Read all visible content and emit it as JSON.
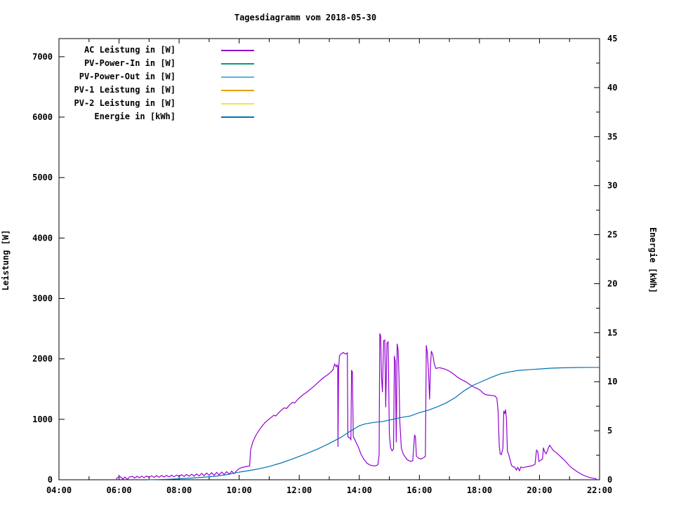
{
  "chart_data": {
    "type": "line",
    "title": "Tagesdiagramm vom 2018-05-30",
    "ylabel": "Leistung [W]",
    "y2label": "Energie [kWh]",
    "background": "#ffffff",
    "border_color": "#000000",
    "grid": false,
    "legend_position": "top-left-inside",
    "xlim": [
      4,
      22
    ],
    "ylim": [
      0,
      7300
    ],
    "y2lim": [
      0,
      45
    ],
    "x_ticks": [
      {
        "t": 4,
        "label": "04:00"
      },
      {
        "t": 6,
        "label": "06:00"
      },
      {
        "t": 8,
        "label": "08:00"
      },
      {
        "t": 10,
        "label": "10:00"
      },
      {
        "t": 12,
        "label": "12:00"
      },
      {
        "t": 14,
        "label": "14:00"
      },
      {
        "t": 16,
        "label": "16:00"
      },
      {
        "t": 18,
        "label": "18:00"
      },
      {
        "t": 20,
        "label": "20:00"
      },
      {
        "t": 22,
        "label": "22:00"
      }
    ],
    "x_minor_ticks": [
      5,
      7,
      9,
      11,
      13,
      15,
      17,
      19,
      21
    ],
    "y_ticks": [
      0,
      1000,
      2000,
      3000,
      4000,
      5000,
      6000,
      7000
    ],
    "y2_ticks": [
      0,
      5,
      10,
      15,
      20,
      25,
      30,
      35,
      40,
      45
    ],
    "y2_minor_ticks": [
      2.5,
      7.5,
      12.5,
      17.5,
      22.5,
      27.5,
      32.5,
      37.5,
      42.5
    ],
    "series": [
      {
        "name": "AC Leistung in [W]",
        "color": "#9400d3",
        "axis": "y1",
        "points": [
          [
            5.9,
            0
          ],
          [
            5.95,
            40
          ],
          [
            6.05,
            50
          ],
          [
            6.13,
            10
          ],
          [
            6.2,
            45
          ],
          [
            6.28,
            5
          ],
          [
            6.35,
            48
          ],
          [
            6.45,
            55
          ],
          [
            6.52,
            28
          ],
          [
            6.6,
            58
          ],
          [
            6.68,
            32
          ],
          [
            6.75,
            60
          ],
          [
            6.83,
            35
          ],
          [
            6.92,
            62
          ],
          [
            7.0,
            38
          ],
          [
            7.08,
            65
          ],
          [
            7.17,
            40
          ],
          [
            7.25,
            68
          ],
          [
            7.33,
            42
          ],
          [
            7.42,
            70
          ],
          [
            7.5,
            45
          ],
          [
            7.58,
            72
          ],
          [
            7.67,
            48
          ],
          [
            7.75,
            75
          ],
          [
            7.83,
            50
          ],
          [
            7.92,
            78
          ],
          [
            8.0,
            52
          ],
          [
            8.08,
            82
          ],
          [
            8.17,
            55
          ],
          [
            8.25,
            88
          ],
          [
            8.33,
            58
          ],
          [
            8.42,
            92
          ],
          [
            8.5,
            60
          ],
          [
            8.58,
            98
          ],
          [
            8.67,
            64
          ],
          [
            8.75,
            104
          ],
          [
            8.83,
            68
          ],
          [
            8.92,
            110
          ],
          [
            9.0,
            72
          ],
          [
            9.08,
            116
          ],
          [
            9.17,
            76
          ],
          [
            9.25,
            122
          ],
          [
            9.33,
            80
          ],
          [
            9.42,
            128
          ],
          [
            9.5,
            85
          ],
          [
            9.58,
            134
          ],
          [
            9.67,
            92
          ],
          [
            9.75,
            142
          ],
          [
            9.83,
            100
          ],
          [
            9.92,
            152
          ],
          [
            10.0,
            185
          ],
          [
            10.1,
            205
          ],
          [
            10.2,
            215
          ],
          [
            10.3,
            225
          ],
          [
            10.35,
            230
          ],
          [
            10.38,
            490
          ],
          [
            10.45,
            620
          ],
          [
            10.55,
            730
          ],
          [
            10.65,
            810
          ],
          [
            10.75,
            880
          ],
          [
            10.85,
            940
          ],
          [
            10.95,
            985
          ],
          [
            11.05,
            1025
          ],
          [
            11.15,
            1065
          ],
          [
            11.22,
            1055
          ],
          [
            11.3,
            1100
          ],
          [
            11.4,
            1150
          ],
          [
            11.5,
            1190
          ],
          [
            11.58,
            1180
          ],
          [
            11.68,
            1240
          ],
          [
            11.78,
            1280
          ],
          [
            11.85,
            1270
          ],
          [
            11.95,
            1330
          ],
          [
            12.05,
            1375
          ],
          [
            12.15,
            1415
          ],
          [
            12.25,
            1450
          ],
          [
            12.35,
            1490
          ],
          [
            12.45,
            1530
          ],
          [
            12.55,
            1575
          ],
          [
            12.65,
            1620
          ],
          [
            12.75,
            1665
          ],
          [
            12.85,
            1705
          ],
          [
            12.95,
            1740
          ],
          [
            13.05,
            1780
          ],
          [
            13.12,
            1815
          ],
          [
            13.18,
            1915
          ],
          [
            13.23,
            1870
          ],
          [
            13.26,
            1900
          ],
          [
            13.28,
            1890
          ],
          [
            13.29,
            545
          ],
          [
            13.31,
            1840
          ],
          [
            13.34,
            2050
          ],
          [
            13.4,
            2085
          ],
          [
            13.47,
            2105
          ],
          [
            13.54,
            2080
          ],
          [
            13.6,
            2100
          ],
          [
            13.62,
            710
          ],
          [
            13.68,
            690
          ],
          [
            13.72,
            665
          ],
          [
            13.74,
            1805
          ],
          [
            13.77,
            1790
          ],
          [
            13.8,
            710
          ],
          [
            13.85,
            665
          ],
          [
            13.9,
            610
          ],
          [
            13.97,
            540
          ],
          [
            14.05,
            430
          ],
          [
            14.15,
            340
          ],
          [
            14.25,
            275
          ],
          [
            14.35,
            245
          ],
          [
            14.45,
            232
          ],
          [
            14.55,
            230
          ],
          [
            14.62,
            250
          ],
          [
            14.66,
            420
          ],
          [
            14.68,
            2420
          ],
          [
            14.71,
            2380
          ],
          [
            14.74,
            1700
          ],
          [
            14.77,
            1450
          ],
          [
            14.81,
            2300
          ],
          [
            14.85,
            2310
          ],
          [
            14.88,
            1200
          ],
          [
            14.92,
            2260
          ],
          [
            14.96,
            2280
          ],
          [
            15.0,
            750
          ],
          [
            15.04,
            530
          ],
          [
            15.09,
            480
          ],
          [
            15.14,
            510
          ],
          [
            15.17,
            2050
          ],
          [
            15.2,
            1950
          ],
          [
            15.23,
            620
          ],
          [
            15.26,
            2250
          ],
          [
            15.29,
            2150
          ],
          [
            15.32,
            1750
          ],
          [
            15.35,
            950
          ],
          [
            15.4,
            520
          ],
          [
            15.46,
            430
          ],
          [
            15.52,
            380
          ],
          [
            15.6,
            330
          ],
          [
            15.7,
            305
          ],
          [
            15.78,
            315
          ],
          [
            15.84,
            745
          ],
          [
            15.87,
            700
          ],
          [
            15.9,
            390
          ],
          [
            15.98,
            355
          ],
          [
            16.06,
            345
          ],
          [
            16.14,
            365
          ],
          [
            16.2,
            385
          ],
          [
            16.23,
            2225
          ],
          [
            16.26,
            2120
          ],
          [
            16.3,
            1820
          ],
          [
            16.34,
            1330
          ],
          [
            16.37,
            1890
          ],
          [
            16.4,
            2130
          ],
          [
            16.45,
            2060
          ],
          [
            16.5,
            1910
          ],
          [
            16.55,
            1840
          ],
          [
            16.65,
            1855
          ],
          [
            16.75,
            1845
          ],
          [
            16.85,
            1830
          ],
          [
            16.95,
            1810
          ],
          [
            17.05,
            1780
          ],
          [
            17.15,
            1745
          ],
          [
            17.25,
            1705
          ],
          [
            17.35,
            1670
          ],
          [
            17.45,
            1645
          ],
          [
            17.55,
            1620
          ],
          [
            17.65,
            1585
          ],
          [
            17.75,
            1550
          ],
          [
            17.85,
            1525
          ],
          [
            17.95,
            1505
          ],
          [
            18.05,
            1470
          ],
          [
            18.12,
            1435
          ],
          [
            18.2,
            1410
          ],
          [
            18.3,
            1400
          ],
          [
            18.42,
            1395
          ],
          [
            18.52,
            1385
          ],
          [
            18.58,
            1350
          ],
          [
            18.62,
            1150
          ],
          [
            18.66,
            560
          ],
          [
            18.69,
            430
          ],
          [
            18.73,
            415
          ],
          [
            18.78,
            520
          ],
          [
            18.81,
            1140
          ],
          [
            18.84,
            1090
          ],
          [
            18.87,
            1160
          ],
          [
            18.9,
            1000
          ],
          [
            18.93,
            470
          ],
          [
            18.97,
            425
          ],
          [
            19.02,
            330
          ],
          [
            19.07,
            235
          ],
          [
            19.12,
            215
          ],
          [
            19.18,
            205
          ],
          [
            19.23,
            160
          ],
          [
            19.28,
            205
          ],
          [
            19.33,
            150
          ],
          [
            19.38,
            210
          ],
          [
            19.45,
            200
          ],
          [
            19.55,
            212
          ],
          [
            19.65,
            220
          ],
          [
            19.75,
            232
          ],
          [
            19.85,
            255
          ],
          [
            19.9,
            490
          ],
          [
            19.94,
            470
          ],
          [
            19.98,
            305
          ],
          [
            20.04,
            325
          ],
          [
            20.1,
            345
          ],
          [
            20.13,
            530
          ],
          [
            20.17,
            465
          ],
          [
            20.22,
            430
          ],
          [
            20.27,
            490
          ],
          [
            20.31,
            545
          ],
          [
            20.34,
            570
          ],
          [
            20.4,
            525
          ],
          [
            20.47,
            480
          ],
          [
            20.55,
            450
          ],
          [
            20.65,
            405
          ],
          [
            20.75,
            360
          ],
          [
            20.85,
            315
          ],
          [
            20.95,
            255
          ],
          [
            21.05,
            205
          ],
          [
            21.15,
            170
          ],
          [
            21.25,
            135
          ],
          [
            21.35,
            105
          ],
          [
            21.45,
            78
          ],
          [
            21.55,
            58
          ],
          [
            21.65,
            40
          ],
          [
            21.75,
            28
          ],
          [
            21.85,
            18
          ],
          [
            21.9,
            12
          ]
        ]
      },
      {
        "name": "PV-Power-In in [W]",
        "color": "#009e73",
        "axis": "y1",
        "points": []
      },
      {
        "name": "PV-Power-Out in [W]",
        "color": "#56b4e9",
        "axis": "y1",
        "points": []
      },
      {
        "name": "PV-1 Leistung in [W]",
        "color": "#e69f00",
        "axis": "y1",
        "points": []
      },
      {
        "name": "PV-2 Leistung in [W]",
        "color": "#f0e442",
        "axis": "y1",
        "points": []
      },
      {
        "name": "Energie in [kWh]",
        "color": "#0072b2",
        "axis": "y2",
        "points": [
          [
            6.95,
            0
          ],
          [
            7.3,
            0.02
          ],
          [
            7.7,
            0.06
          ],
          [
            8.0,
            0.1
          ],
          [
            8.4,
            0.17
          ],
          [
            8.8,
            0.26
          ],
          [
            9.2,
            0.36
          ],
          [
            9.6,
            0.52
          ],
          [
            10.0,
            0.78
          ],
          [
            10.3,
            0.92
          ],
          [
            10.6,
            1.08
          ],
          [
            11.0,
            1.35
          ],
          [
            11.4,
            1.72
          ],
          [
            11.8,
            2.15
          ],
          [
            12.2,
            2.62
          ],
          [
            12.6,
            3.12
          ],
          [
            13.0,
            3.7
          ],
          [
            13.4,
            4.35
          ],
          [
            13.7,
            4.95
          ],
          [
            14.0,
            5.5
          ],
          [
            14.2,
            5.7
          ],
          [
            14.5,
            5.85
          ],
          [
            14.8,
            5.95
          ],
          [
            15.1,
            6.15
          ],
          [
            15.4,
            6.35
          ],
          [
            15.7,
            6.5
          ],
          [
            16.0,
            6.85
          ],
          [
            16.3,
            7.1
          ],
          [
            16.6,
            7.45
          ],
          [
            16.9,
            7.85
          ],
          [
            17.2,
            8.4
          ],
          [
            17.5,
            9.1
          ],
          [
            17.8,
            9.65
          ],
          [
            18.1,
            10.05
          ],
          [
            18.4,
            10.45
          ],
          [
            18.7,
            10.8
          ],
          [
            19.0,
            11.0
          ],
          [
            19.3,
            11.15
          ],
          [
            19.6,
            11.22
          ],
          [
            20.0,
            11.3
          ],
          [
            20.4,
            11.38
          ],
          [
            20.8,
            11.42
          ],
          [
            21.2,
            11.45
          ],
          [
            21.6,
            11.46
          ],
          [
            22.0,
            11.46
          ]
        ]
      }
    ]
  }
}
